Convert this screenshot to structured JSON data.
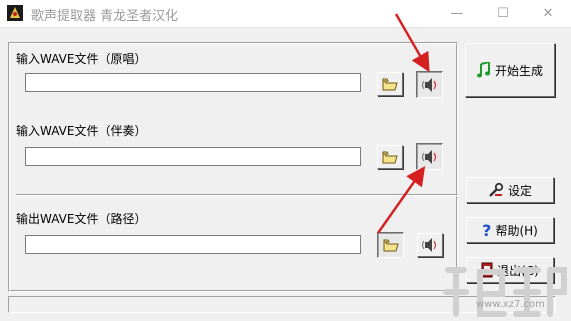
{
  "window": {
    "title": "歌声提取器 青龙圣者汉化",
    "minimize_symbol": "—",
    "maximize_symbol": "☐",
    "close_symbol": "✕"
  },
  "inputs": {
    "original_label": "输入WAVE文件（原唱）",
    "original_value": "",
    "accompaniment_label": "输入WAVE文件（伴奏）",
    "accompaniment_value": "",
    "output_label": "输出WAVE文件（路径）",
    "output_value": ""
  },
  "buttons": {
    "start_label": "开始生成",
    "settings_label": "设定",
    "help_label": "帮助(H)",
    "exit_label": "退出(C)"
  },
  "icons": {
    "browse": "folder-icon",
    "play": "speaker-icon",
    "start": "music-note-icon",
    "settings": "tools-icon",
    "help": "question-mark-icon",
    "exit": "exit-door-icon",
    "app": "app-icon"
  },
  "status": {
    "text": ""
  },
  "watermark": {
    "text": "www.xz7.com"
  },
  "colors": {
    "annotation_arrow": "#d42020",
    "window_bg": "#f0f0f0",
    "title_text": "#9b9b9b",
    "start_icon": "#1e9b2a",
    "help_icon": "#2451c9"
  }
}
